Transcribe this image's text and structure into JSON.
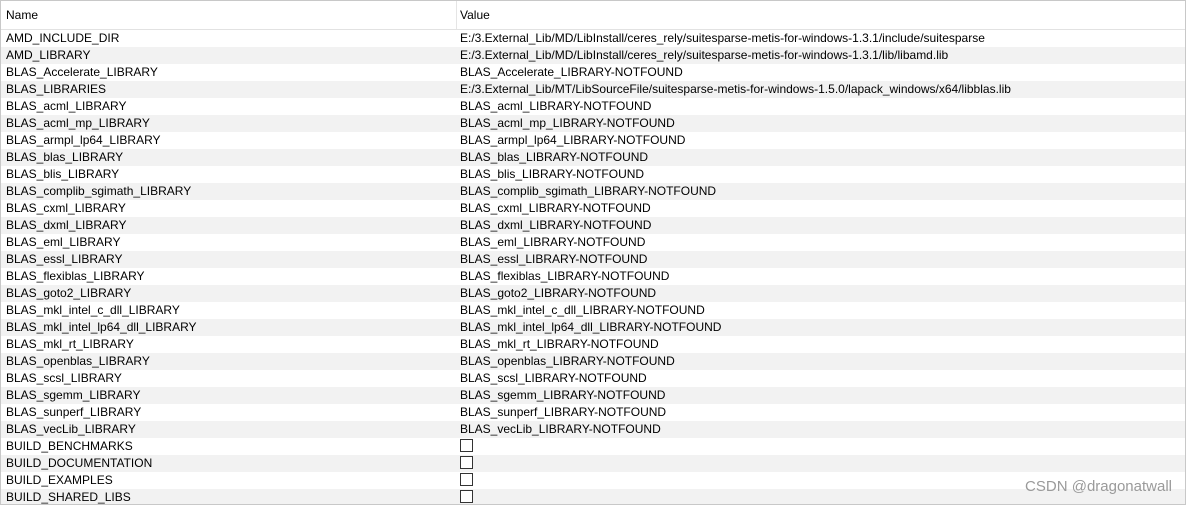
{
  "columns": {
    "name": "Name",
    "value": "Value"
  },
  "rows": [
    {
      "name": "AMD_INCLUDE_DIR",
      "value": "E:/3.External_Lib/MD/LibInstall/ceres_rely/suitesparse-metis-for-windows-1.3.1/include/suitesparse"
    },
    {
      "name": "AMD_LIBRARY",
      "value": "E:/3.External_Lib/MD/LibInstall/ceres_rely/suitesparse-metis-for-windows-1.3.1/lib/libamd.lib"
    },
    {
      "name": "BLAS_Accelerate_LIBRARY",
      "value": "BLAS_Accelerate_LIBRARY-NOTFOUND"
    },
    {
      "name": "BLAS_LIBRARIES",
      "value": "E:/3.External_Lib/MT/LibSourceFile/suitesparse-metis-for-windows-1.5.0/lapack_windows/x64/libblas.lib"
    },
    {
      "name": "BLAS_acml_LIBRARY",
      "value": "BLAS_acml_LIBRARY-NOTFOUND"
    },
    {
      "name": "BLAS_acml_mp_LIBRARY",
      "value": "BLAS_acml_mp_LIBRARY-NOTFOUND"
    },
    {
      "name": "BLAS_armpl_lp64_LIBRARY",
      "value": "BLAS_armpl_lp64_LIBRARY-NOTFOUND"
    },
    {
      "name": "BLAS_blas_LIBRARY",
      "value": "BLAS_blas_LIBRARY-NOTFOUND"
    },
    {
      "name": "BLAS_blis_LIBRARY",
      "value": "BLAS_blis_LIBRARY-NOTFOUND"
    },
    {
      "name": "BLAS_complib_sgimath_LIBRARY",
      "value": "BLAS_complib_sgimath_LIBRARY-NOTFOUND"
    },
    {
      "name": "BLAS_cxml_LIBRARY",
      "value": "BLAS_cxml_LIBRARY-NOTFOUND"
    },
    {
      "name": "BLAS_dxml_LIBRARY",
      "value": "BLAS_dxml_LIBRARY-NOTFOUND"
    },
    {
      "name": "BLAS_eml_LIBRARY",
      "value": "BLAS_eml_LIBRARY-NOTFOUND"
    },
    {
      "name": "BLAS_essl_LIBRARY",
      "value": "BLAS_essl_LIBRARY-NOTFOUND"
    },
    {
      "name": "BLAS_flexiblas_LIBRARY",
      "value": "BLAS_flexiblas_LIBRARY-NOTFOUND"
    },
    {
      "name": "BLAS_goto2_LIBRARY",
      "value": "BLAS_goto2_LIBRARY-NOTFOUND"
    },
    {
      "name": "BLAS_mkl_intel_c_dll_LIBRARY",
      "value": "BLAS_mkl_intel_c_dll_LIBRARY-NOTFOUND"
    },
    {
      "name": "BLAS_mkl_intel_lp64_dll_LIBRARY",
      "value": "BLAS_mkl_intel_lp64_dll_LIBRARY-NOTFOUND"
    },
    {
      "name": "BLAS_mkl_rt_LIBRARY",
      "value": "BLAS_mkl_rt_LIBRARY-NOTFOUND"
    },
    {
      "name": "BLAS_openblas_LIBRARY",
      "value": "BLAS_openblas_LIBRARY-NOTFOUND"
    },
    {
      "name": "BLAS_scsl_LIBRARY",
      "value": "BLAS_scsl_LIBRARY-NOTFOUND"
    },
    {
      "name": "BLAS_sgemm_LIBRARY",
      "value": "BLAS_sgemm_LIBRARY-NOTFOUND"
    },
    {
      "name": "BLAS_sunperf_LIBRARY",
      "value": "BLAS_sunperf_LIBRARY-NOTFOUND"
    },
    {
      "name": "BLAS_vecLib_LIBRARY",
      "value": "BLAS_vecLib_LIBRARY-NOTFOUND"
    },
    {
      "name": "BUILD_BENCHMARKS",
      "checkbox": false
    },
    {
      "name": "BUILD_DOCUMENTATION",
      "checkbox": false
    },
    {
      "name": "BUILD_EXAMPLES",
      "checkbox": false
    },
    {
      "name": "BUILD_SHARED_LIBS",
      "checkbox": false
    }
  ],
  "watermark": "CSDN @dragonatwall"
}
